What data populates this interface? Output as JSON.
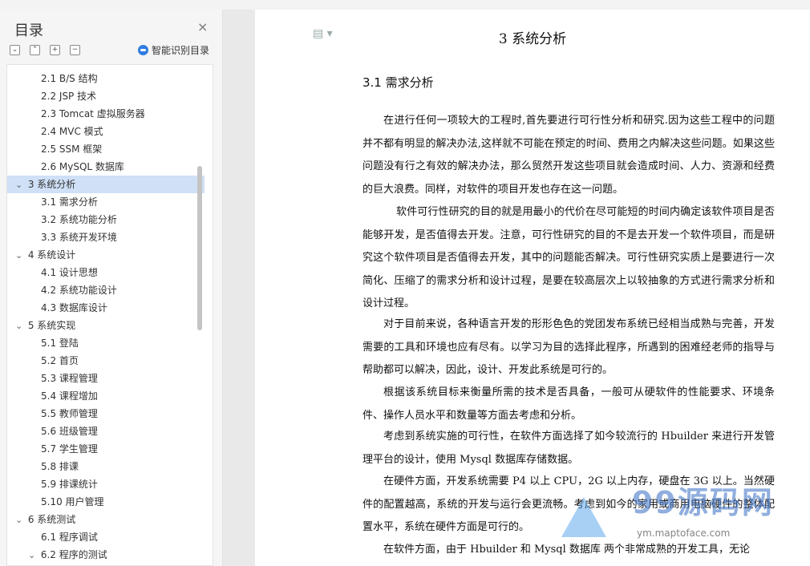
{
  "sidebar": {
    "title": "目录",
    "close": "×",
    "smart_label": "智能识别目录",
    "items": [
      {
        "label": "2.1 B/S 结构"
      },
      {
        "label": "2.2 JSP 技术"
      },
      {
        "label": "2.3 Tomcat 虚拟服务器"
      },
      {
        "label": "2.4 MVC 模式"
      },
      {
        "label": "2.5 SSM 框架"
      },
      {
        "label": "2.6 MySQL 数据库"
      },
      {
        "label": "3 系统分析"
      },
      {
        "label": "3.1 需求分析"
      },
      {
        "label": "3.2 系统功能分析"
      },
      {
        "label": "3.3 系统开发环境"
      },
      {
        "label": "4 系统设计"
      },
      {
        "label": "4.1 设计思想"
      },
      {
        "label": "4.2 系统功能设计"
      },
      {
        "label": "4.3 数据库设计"
      },
      {
        "label": "5 系统实现"
      },
      {
        "label": "5.1 登陆"
      },
      {
        "label": "5.2 首页"
      },
      {
        "label": "5.3 课程管理"
      },
      {
        "label": "5.4 课程增加"
      },
      {
        "label": "5.5 教师管理"
      },
      {
        "label": "5.6 班级管理"
      },
      {
        "label": "5.7 学生管理"
      },
      {
        "label": "5.8 排课"
      },
      {
        "label": "5.9 排课统计"
      },
      {
        "label": "5.10 用户管理"
      },
      {
        "label": "6 系统测试"
      },
      {
        "label": "6.1 程序调试"
      },
      {
        "label": "6.2 程序的测试"
      }
    ]
  },
  "document": {
    "chapter_title": "3 系统分析",
    "section_title": "3.1 需求分析",
    "paragraphs": [
      "在进行任何一项较大的工程时,首先要进行可行性分析和研究.因为这些工程中的问题并不都有明显的解决办法,这样就不可能在预定的时间、费用之内解决这些问题。如果这些问题没有行之有效的解决办法，那么贸然开发这些项目就会造成时间、人力、资源和经费的巨大浪费。同样，对软件的项目开发也存在这一问题。",
      "软件可行性研究的目的就是用最小的代价在尽可能短的时间内确定该软件项目是否能够开发，是否值得去开发。注意，可行性研究的目的不是去开发一个软件项目，而是研究这个软件项目是否值得去开发，其中的问题能否解决。可行性研究实质上是要进行一次简化、压缩了的需求分析和设计过程，是要在较高层次上以较抽象的方式进行需求分析和设计过程。",
      "对于目前来说，各种语言开发的形形色色的党团发布系统已经相当成熟与完善，开发需要的工具和环境也应有尽有。以学习为目的选择此程序，所遇到的困难经老师的指导与帮助都可以解决，因此，设计、开发此系统是可行的。",
      "根据该系统目标来衡量所需的技术是否具备，一般可从硬软件的性能要求、环境条件、操作人员水平和数量等方面去考虑和分析。",
      "考虑到系统实施的可行性，在软件方面选择了如今较流行的 Hbuilder 来进行开发管理平台的设计，使用 Mysql 数据库存储数据。",
      "在硬件方面，开发系统需要 P4 以上 CPU，2G 以上内存，硬盘在 3G 以上。当然硬件的配置越高，系统的开发与运行会更流畅。考虑到如今的家用或商用电脑硬件的整体配置水平，系统在硬件方面是可行的。",
      "在软件方面，由于 Hbuilder 和 Mysql 数据库 两个非常成熟的开发工具，无论"
    ]
  },
  "watermark": {
    "text": "99源码网",
    "url": "ym.maptoface.com"
  }
}
